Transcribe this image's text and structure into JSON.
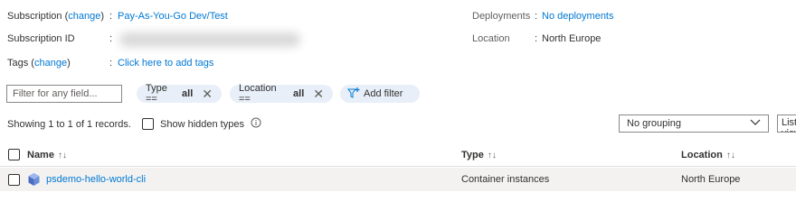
{
  "essentials": {
    "subscription_label": "Subscription",
    "change_link": "change",
    "subscription_value": "Pay-As-You-Go Dev/Test",
    "subscription_id_label": "Subscription ID",
    "tags_label": "Tags",
    "tags_value": "Click here to add tags",
    "deployments_label": "Deployments",
    "deployments_value": "No deployments",
    "location_label": "Location",
    "location_value": "North Europe"
  },
  "filters": {
    "filter_placeholder": "Filter for any field...",
    "type_pill": {
      "prefix": "Type ==",
      "value": "all"
    },
    "location_pill": {
      "prefix": "Location ==",
      "value": "all"
    },
    "add_filter": "Add filter"
  },
  "records": {
    "summary": "Showing 1 to 1 of 1 records.",
    "show_hidden": "Show hidden types",
    "grouping": "No grouping",
    "view_button": "List view"
  },
  "table": {
    "headers": {
      "name": "Name",
      "type": "Type",
      "location": "Location"
    },
    "rows": [
      {
        "name": "psdemo-hello-world-cli",
        "type": "Container instances",
        "location": "North Europe"
      }
    ]
  },
  "colors": {
    "accent": "#0078d4",
    "pill_bg": "#e8eff8",
    "row_bg": "#f3f2f1"
  }
}
